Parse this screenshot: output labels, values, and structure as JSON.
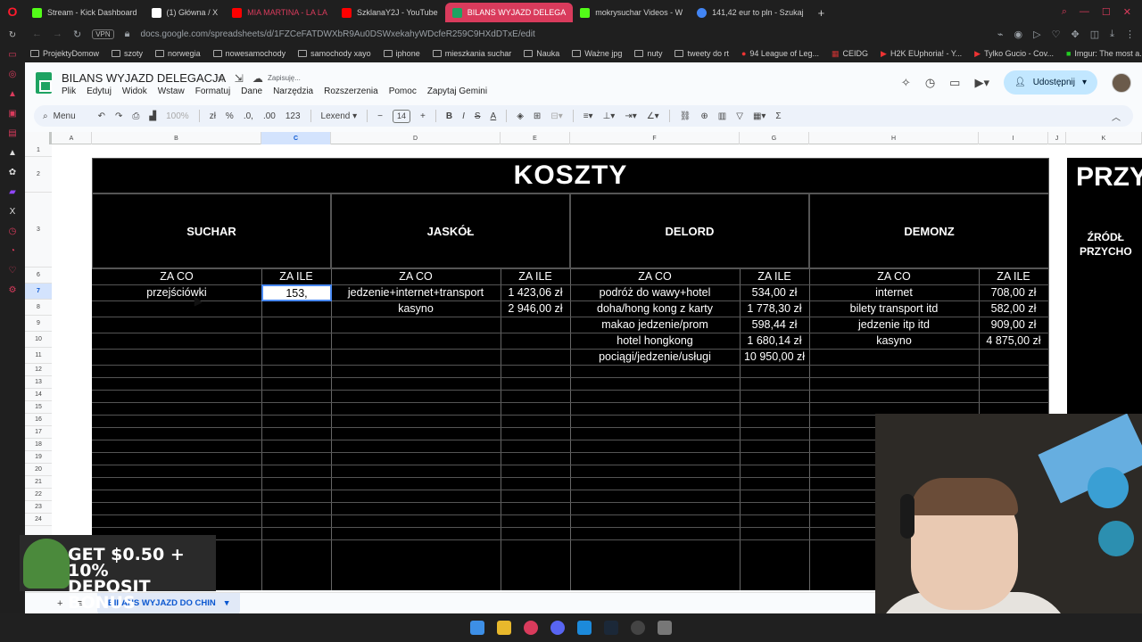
{
  "browser": {
    "tabs": [
      {
        "label": "Stream - Kick Dashboard",
        "color": "#53fc18"
      },
      {
        "label": "(1) Główna / X",
        "color": "#ffffff"
      },
      {
        "label": "MIA MARTINA - LA LA",
        "color": "#ff0000"
      },
      {
        "label": "SzklanaY2J - YouTube",
        "color": "#ff0000"
      },
      {
        "label": "BILANS WYJAZD DELEGA",
        "color": "#1ea362",
        "active": true
      },
      {
        "label": "mokrysuchar Videos - W",
        "color": "#53fc18"
      },
      {
        "label": "141,42 eur to pln - Szukaj",
        "color": "#4285f4"
      }
    ],
    "new_tab": "+",
    "vpn_label": "VPN",
    "url": "docs.google.com/spreadsheets/d/1FZCeFATDWXbR9Au0DSWxekahyWDcfeR259C9HXdDTxE/edit",
    "bookmarks": [
      "ProjektyDomow",
      "szoty",
      "norwegia",
      "nowesamochody",
      "samochody xayo",
      "iphone",
      "mieszkania suchar",
      "Nauka",
      "Ważne jpg",
      "nuty",
      "tweety do rt",
      "94 League of Leg...",
      "CEIDG",
      "H2K EUphoria! - Y...",
      "Tylko Gucio - Cov...",
      "Imgur: The most a..."
    ]
  },
  "sheets": {
    "doc_title": "BILANS WYJAZD DELEGACJA",
    "saving_status": "Zapisuję...",
    "menu": [
      "Plik",
      "Edytuj",
      "Widok",
      "Wstaw",
      "Formatuj",
      "Dane",
      "Narzędzia",
      "Rozszerzenia",
      "Pomoc",
      "Zapytaj Gemini"
    ],
    "share_label": "Udostępnij",
    "toolbar": {
      "menu_label": "Menu",
      "zoom": "100%",
      "currency": "zł",
      "percent": "%",
      "dec_less": ".0,",
      "dec_more": ".00",
      "number_format": "123",
      "font": "Lexend",
      "font_size": "14",
      "bold": "B",
      "italic": "I",
      "strike": "S",
      "text_color": "A",
      "sum": "Σ"
    },
    "columns": [
      "A",
      "B",
      "C",
      "D",
      "E",
      "F",
      "G",
      "H",
      "I",
      "J",
      "K"
    ],
    "rows": [
      "1",
      "2",
      "3",
      "6",
      "7",
      "8",
      "9",
      "10",
      "11",
      "12",
      "13",
      "14",
      "15",
      "16",
      "17",
      "18",
      "19",
      "20",
      "21",
      "22",
      "23",
      "24"
    ],
    "sheet_tab": "BILANS WYJAZD DO CHIN"
  },
  "table": {
    "title": "KOSZTY",
    "side_title": "PRZY",
    "side_subtitle_1": "ŹRÓDŁ",
    "side_subtitle_2": "PRZYCHO",
    "people": [
      "SUCHAR",
      "JASKÓŁ",
      "DELORD",
      "DEMONZ"
    ],
    "header_what": "ZA CO",
    "header_how_much": "ZA ILE",
    "editing_value": "153,",
    "suchar": [
      {
        "what": "przejściówki",
        "amount": ""
      }
    ],
    "jaskol": [
      {
        "what": "jedzenie+internet+transport",
        "amount": "1 423,06 zł"
      },
      {
        "what": "kasyno",
        "amount": "2 946,00 zł"
      }
    ],
    "delord": [
      {
        "what": "podróż do wawy+hotel",
        "amount": "534,00 zł"
      },
      {
        "what": "doha/hong kong z karty",
        "amount": "1 778,30 zł"
      },
      {
        "what": "makao jedzenie/prom",
        "amount": "598,44 zł"
      },
      {
        "what": "hotel hongkong",
        "amount": "1 680,14 zł"
      },
      {
        "what": "pociągi/jedzenie/usługi",
        "amount": "10 950,00 zł"
      }
    ],
    "demonz": [
      {
        "what": "internet",
        "amount": "708,00 zł"
      },
      {
        "what": "bilety transport itd",
        "amount": "582,00 zł"
      },
      {
        "what": "jedzenie itp itd",
        "amount": "909,00 zł"
      },
      {
        "what": "kasyno",
        "amount": "4 875,00 zł"
      }
    ]
  },
  "ad": {
    "line1": "GET $0.50 + 10%",
    "line2": "DEPOSIT BONUS"
  }
}
